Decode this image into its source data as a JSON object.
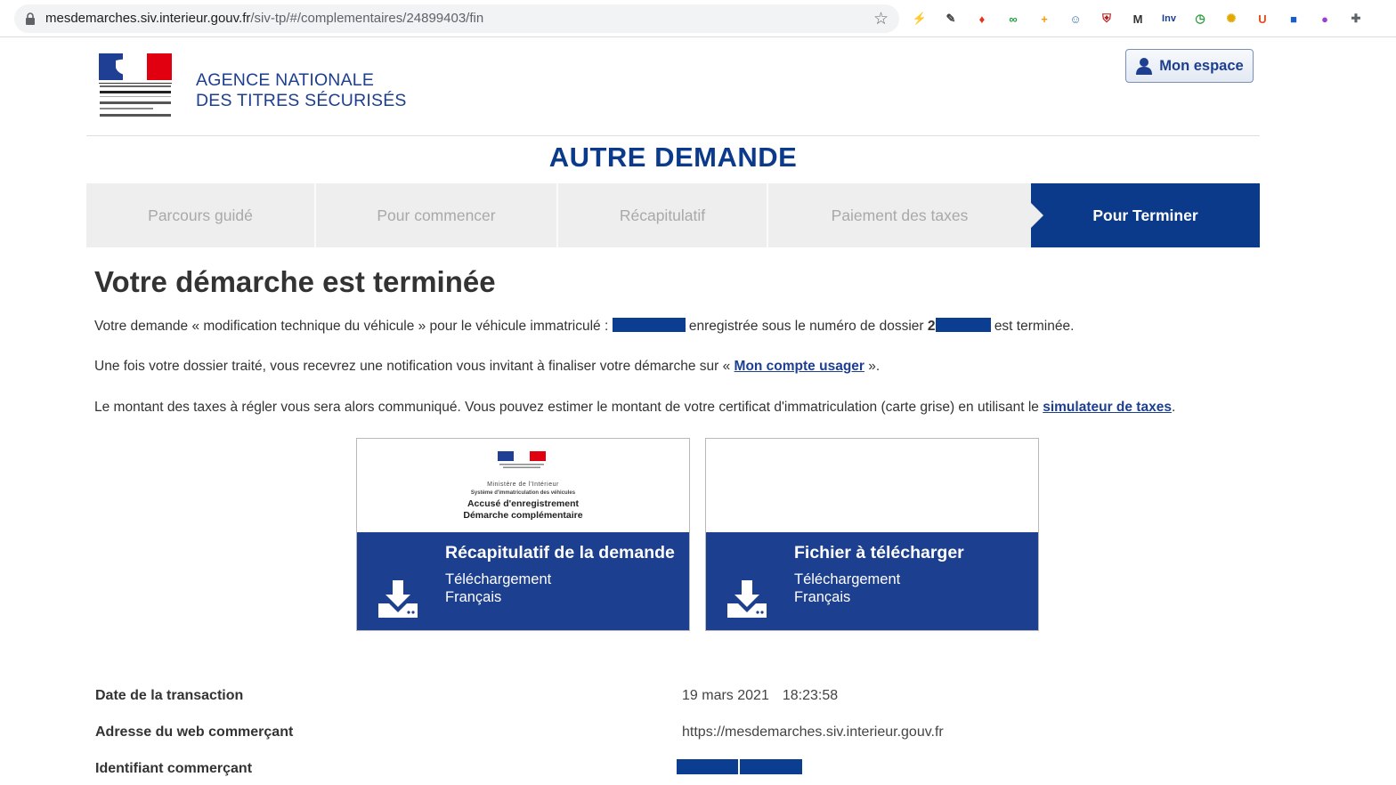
{
  "browser": {
    "url_host": "mesdemarches.siv.interieur.gouv.fr",
    "url_path": "/siv-tp/#/complementaires/24899403/fin",
    "extensions": [
      {
        "name": "bolt-icon",
        "glyph": "⚡",
        "color": "#5b6bd6"
      },
      {
        "name": "eyedropper-icon",
        "glyph": "✎",
        "color": "#444444"
      },
      {
        "name": "pin-icon",
        "glyph": "♦",
        "color": "#e8331b"
      },
      {
        "name": "infinity-icon",
        "glyph": "∞",
        "color": "#1b9e3a"
      },
      {
        "name": "plus-badge-icon",
        "glyph": "+",
        "color": "#f59a00"
      },
      {
        "name": "chat-icon",
        "glyph": "☺",
        "color": "#3a6fb0"
      },
      {
        "name": "shield-icon",
        "glyph": "⛨",
        "color": "#b01e1e"
      },
      {
        "name": "m-icon",
        "glyph": "M",
        "color": "#333333"
      },
      {
        "name": "inv-icon",
        "glyph": "Inv",
        "color": "#1a3d8f"
      },
      {
        "name": "compass-icon",
        "glyph": "◷",
        "color": "#2a9d3a"
      },
      {
        "name": "sun-icon",
        "glyph": "✺",
        "color": "#e0a800"
      },
      {
        "name": "u-icon",
        "glyph": "U",
        "color": "#e64a19"
      },
      {
        "name": "square-icon",
        "glyph": "■",
        "color": "#1a5fc7"
      },
      {
        "name": "circle-icon",
        "glyph": "●",
        "color": "#9b3fd1"
      },
      {
        "name": "puzzle-icon",
        "glyph": "✚",
        "color": "#5f6368"
      }
    ]
  },
  "header": {
    "agency_line1": "AGENCE NATIONALE",
    "agency_line2": "DES TITRES SÉCURISÉS",
    "mon_espace_label": "Mon espace"
  },
  "page_heading": "AUTRE DEMANDE",
  "steps": [
    {
      "label": "Parcours guidé",
      "active": false
    },
    {
      "label": "Pour commencer",
      "active": false
    },
    {
      "label": "Récapitulatif",
      "active": false
    },
    {
      "label": "Paiement des taxes",
      "active": false
    },
    {
      "label": "Pour Terminer",
      "active": true
    }
  ],
  "main": {
    "title": "Votre démarche est terminée",
    "p1_a": "Votre demande « modification technique du véhicule » pour le véhicule immatriculé :",
    "p1_b": "enregistrée sous le numéro de dossier",
    "p1_digit": "2",
    "p1_c": "est terminée.",
    "p2_a": "Une fois votre dossier traité, vous recevrez une notification vous invitant à finaliser votre démarche sur «",
    "p2_link": "Mon compte usager",
    "p2_b": "».",
    "p3_a": "Le montant des taxes à régler vous sera alors communiqué. Vous pouvez estimer le montant de votre certificat d'immatriculation (carte grise) en utilisant le",
    "p3_link": "simulateur de taxes",
    "p3_b": "."
  },
  "cards": [
    {
      "title": "Récapitulatif de la demande",
      "sub1": "Téléchargement",
      "sub2": "Français",
      "doc_ministere": "Ministère de l'Intérieur",
      "doc_systeme": "Système d'immatriculation des véhicules",
      "doc_line1": "Accusé d'enregistrement",
      "doc_line2": "Démarche complémentaire"
    },
    {
      "title": "Fichier à télécharger",
      "sub1": "Téléchargement",
      "sub2": "Français"
    }
  ],
  "details": {
    "date_label": "Date de la transaction",
    "date_value": "19 mars 2021",
    "time_value": "18:23:58",
    "web_label": "Adresse du web commerçant",
    "web_value": "https://mesdemarches.siv.interieur.gouv.fr",
    "id_label": "Identifiant commerçant"
  },
  "colors": {
    "brand_blue": "#0c3a8b",
    "card_blue": "#1c3f8f",
    "redaction": "#0b3d91"
  }
}
